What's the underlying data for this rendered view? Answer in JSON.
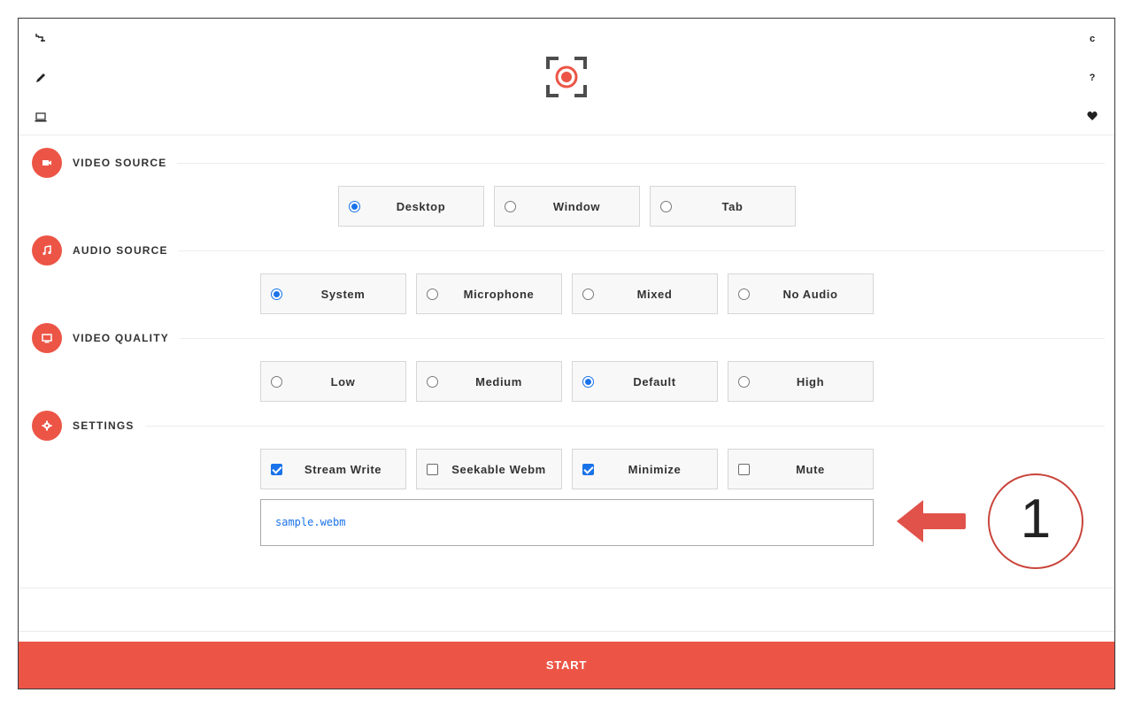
{
  "left_toolbar": [
    {
      "name": "crop-icon"
    },
    {
      "name": "pencil-icon"
    },
    {
      "name": "laptop-icon"
    }
  ],
  "right_toolbar": [
    {
      "name": "refresh-icon",
      "glyph": "c"
    },
    {
      "name": "help-icon",
      "glyph": "?"
    },
    {
      "name": "heart-icon"
    }
  ],
  "logo": {
    "name": "screen-record-logo",
    "accent": "#ec5546"
  },
  "sections": {
    "video_source": {
      "title": "VIDEO SOURCE",
      "icon": "video-camera-icon",
      "options": [
        {
          "label": "Desktop",
          "selected": true
        },
        {
          "label": "Window",
          "selected": false
        },
        {
          "label": "Tab",
          "selected": false
        }
      ]
    },
    "audio_source": {
      "title": "AUDIO SOURCE",
      "icon": "music-note-icon",
      "options": [
        {
          "label": "System",
          "selected": true
        },
        {
          "label": "Microphone",
          "selected": false
        },
        {
          "label": "Mixed",
          "selected": false
        },
        {
          "label": "No Audio",
          "selected": false
        }
      ]
    },
    "video_quality": {
      "title": "VIDEO QUALITY",
      "icon": "monitor-icon",
      "options": [
        {
          "label": "Low",
          "selected": false
        },
        {
          "label": "Medium",
          "selected": false
        },
        {
          "label": "Default",
          "selected": true
        },
        {
          "label": "High",
          "selected": false
        }
      ]
    },
    "settings": {
      "title": "SETTINGS",
      "icon": "gear-icon",
      "options": [
        {
          "label": "Stream Write",
          "checked": true
        },
        {
          "label": "Seekable Webm",
          "checked": false
        },
        {
          "label": "Minimize",
          "checked": true
        },
        {
          "label": "Mute",
          "checked": false
        }
      ],
      "filename": "sample.webm"
    }
  },
  "start_button": {
    "label": "START"
  },
  "annotation": {
    "number": "1",
    "color": "#e0524a"
  },
  "colors": {
    "accent": "#ec5546",
    "selected": "#1a73e8"
  }
}
